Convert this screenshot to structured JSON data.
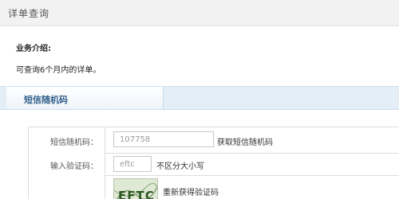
{
  "header": {
    "title": "详单查询"
  },
  "intro": {
    "heading": "业务介绍:",
    "text": "可查询6个月内的详单。"
  },
  "section": {
    "title": "短信随机码"
  },
  "form": {
    "sms_label": "短信随机码：",
    "sms_value": "107758",
    "get_sms_label": "获取短信随机码",
    "captcha_label": "输入验证码：",
    "captcha_value": "eftc",
    "case_hint": "不区分大小写",
    "captcha_image_text": "EFTC",
    "refresh_label": "重新获得验证码"
  }
}
